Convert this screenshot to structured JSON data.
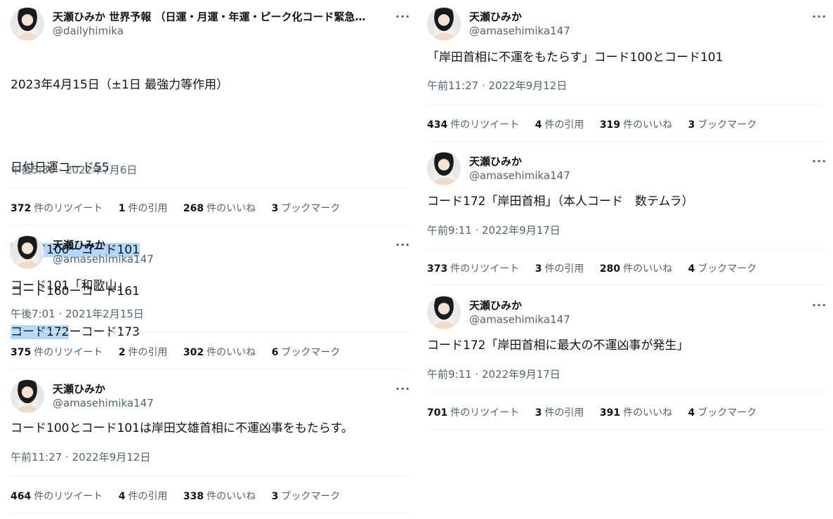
{
  "left_column": [
    {
      "name": "天瀬ひみか 世界予報 （日運・月運・年運・ピーク化コード緊急警…",
      "handle": "@dailyhimika",
      "lines": [
        {
          "plain": "2023年4月15日（±1日 最強力等作用）"
        },
        {
          "plain": ""
        },
        {
          "plain": "日付日運コード55"
        },
        {
          "plain": ""
        },
        {
          "hl": "コード100ーコード101",
          "plain": ""
        },
        {
          "plain": "コード160ーコード161"
        },
        {
          "hl": "コード172",
          "plain": "ーコード173"
        }
      ],
      "time": "午後5:30 · 2022年7月6日",
      "stats": {
        "retweets": "372",
        "retweets_label": "件のリツイート",
        "quotes": "1",
        "quotes_label": "件の引用",
        "likes": "268",
        "likes_label": "件のいいね",
        "bookmarks": "3",
        "bookmarks_label": "ブックマーク"
      }
    },
    {
      "name": "天瀬ひみか",
      "handle": "@amasehimika147",
      "text": "コード101「和歌山」",
      "time": "午後7:01 · 2021年2月15日",
      "stats": {
        "retweets": "375",
        "retweets_label": "件のリツイート",
        "quotes": "2",
        "quotes_label": "件の引用",
        "likes": "302",
        "likes_label": "件のいいね",
        "bookmarks": "6",
        "bookmarks_label": "ブックマーク"
      }
    },
    {
      "name": "天瀬ひみか",
      "handle": "@amasehimika147",
      "text": "コード100とコード101は岸田文雄首相に不運凶事をもたらす。",
      "time": "午前11:27 · 2022年9月12日",
      "stats": {
        "retweets": "464",
        "retweets_label": "件のリツイート",
        "quotes": "4",
        "quotes_label": "件の引用",
        "likes": "338",
        "likes_label": "件のいいね",
        "bookmarks": "3",
        "bookmarks_label": "ブックマーク"
      }
    }
  ],
  "right_column": [
    {
      "name": "天瀬ひみか",
      "handle": "@amasehimika147",
      "text": "「岸田首相に不運をもたらす」コード100とコード101",
      "time": "午前11:27 · 2022年9月12日",
      "stats": {
        "retweets": "434",
        "retweets_label": "件のリツイート",
        "quotes": "4",
        "quotes_label": "件の引用",
        "likes": "319",
        "likes_label": "件のいいね",
        "bookmarks": "3",
        "bookmarks_label": "ブックマーク"
      }
    },
    {
      "name": "天瀬ひみか",
      "handle": "@amasehimika147",
      "text": "コード172「岸田首相」（本人コード　数テムラ）",
      "time": "午前9:11 · 2022年9月17日",
      "stats": {
        "retweets": "373",
        "retweets_label": "件のリツイート",
        "quotes": "3",
        "quotes_label": "件の引用",
        "likes": "280",
        "likes_label": "件のいいね",
        "bookmarks": "4",
        "bookmarks_label": "ブックマーク"
      }
    },
    {
      "name": "天瀬ひみか",
      "handle": "@amasehimika147",
      "text": "コード172「岸田首相に最大の不運凶事が発生」",
      "time": "午前9:11 · 2022年9月17日",
      "stats": {
        "retweets": "701",
        "retweets_label": "件のリツイート",
        "quotes": "3",
        "quotes_label": "件の引用",
        "likes": "391",
        "likes_label": "件のいいね",
        "bookmarks": "4",
        "bookmarks_label": "ブックマーク"
      }
    }
  ],
  "icons": {
    "more": "more-horizontal-icon",
    "avatar": "profile-avatar"
  },
  "more_glyph": "···",
  "colors": {
    "text": "#0f1419",
    "secondary": "#536471",
    "highlight": "#b3d7ff",
    "divider": "#eff3f4"
  }
}
